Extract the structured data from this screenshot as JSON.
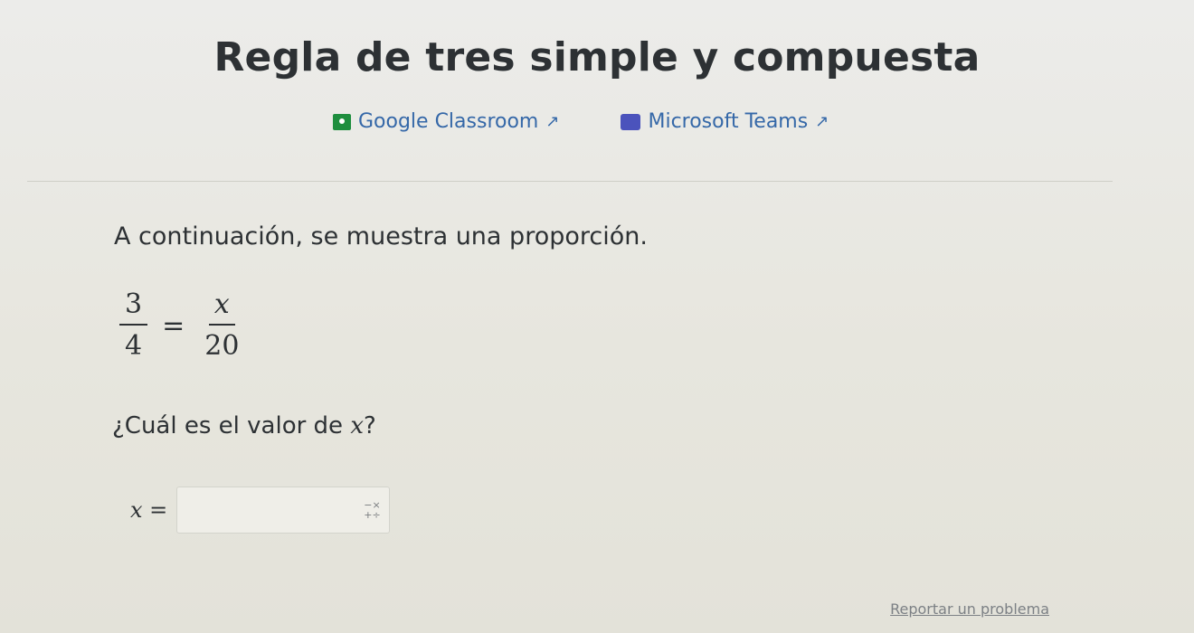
{
  "header": {
    "title": "Regla de tres simple y compuesta"
  },
  "share": {
    "google_classroom": {
      "label": "Google Classroom",
      "icon": "google-classroom-icon"
    },
    "microsoft_teams": {
      "label": "Microsoft Teams",
      "icon": "microsoft-teams-icon"
    },
    "external_icon": "↗"
  },
  "problem": {
    "intro": "A continuación, se muestra una proporción.",
    "equation": {
      "left_numerator": "3",
      "left_denominator": "4",
      "equals": "=",
      "right_numerator": "x",
      "right_denominator": "20"
    },
    "question_prefix": "¿Cuál es el valor de ",
    "question_var": "x",
    "question_suffix": "?"
  },
  "answer": {
    "label": "x =",
    "value": "",
    "placeholder": "",
    "keypad_icon": "−×\n+÷"
  },
  "footer": {
    "report_link": "Reportar un problema"
  },
  "colors": {
    "link": "#3568a8",
    "google_classroom": "#1e8e3e",
    "microsoft_teams": "#4b53bc"
  }
}
